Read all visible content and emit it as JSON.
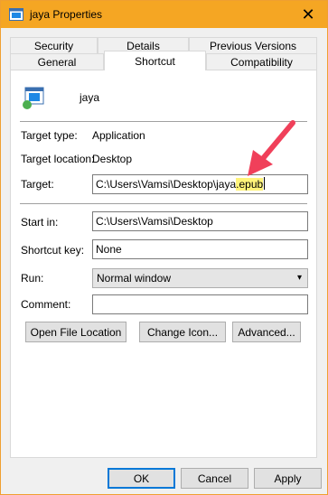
{
  "window": {
    "title": "jaya Properties",
    "close_glyph": "✕"
  },
  "tabs": {
    "row1": [
      "Security",
      "Details",
      "Previous Versions"
    ],
    "row2": [
      "General",
      "Shortcut",
      "Compatibility"
    ],
    "active": "Shortcut"
  },
  "shortcut": {
    "name": "jaya",
    "target_type_label": "Target type:",
    "target_type_value": "Application",
    "target_location_label": "Target location:",
    "target_location_value": "Desktop",
    "target_label": "Target:",
    "target_value_prefix": "C:\\Users\\Vamsi\\Desktop\\jaya",
    "target_value_highlight": ".epub",
    "start_in_label": "Start in:",
    "start_in_value": "C:\\Users\\Vamsi\\Desktop",
    "shortcut_key_label": "Shortcut key:",
    "shortcut_key_value": "None",
    "run_label": "Run:",
    "run_value": "Normal window",
    "comment_label": "Comment:",
    "comment_value": ""
  },
  "actions": {
    "open_file_location": "Open File Location",
    "change_icon": "Change Icon...",
    "advanced": "Advanced..."
  },
  "footer": {
    "ok": "OK",
    "cancel": "Cancel",
    "apply": "Apply"
  },
  "colors": {
    "titlebar": "#f5a623",
    "highlight": "#fff37a",
    "annotation_arrow": "#f0405a"
  }
}
